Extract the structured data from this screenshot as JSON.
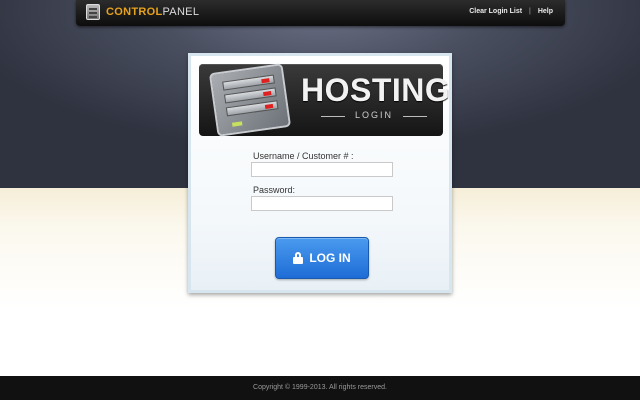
{
  "header": {
    "logo": {
      "part1": "CONTROL",
      "part2": "PANEL"
    },
    "links": {
      "clear_login": "Clear Login List",
      "separator": "|",
      "help": "Help"
    }
  },
  "banner": {
    "title": "HOSTING",
    "subtitle": "LOGIN"
  },
  "form": {
    "username_label": "Username / Customer # :",
    "username_value": "",
    "password_label": "Password:",
    "password_value": "",
    "login_button": "LOG IN"
  },
  "footer": {
    "copyright": "Copyright © 1999-2013. All rights reserved."
  },
  "colors": {
    "accent": "#e8a11c",
    "button": "#2a78e0",
    "header_bg": "#141414"
  },
  "icons": {
    "logo": "server-icon",
    "button": "lock-icon"
  }
}
